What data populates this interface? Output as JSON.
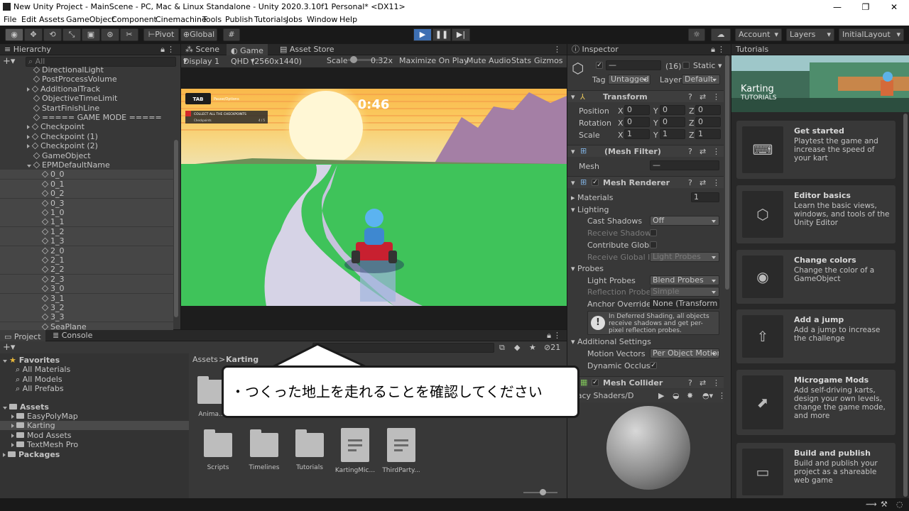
{
  "window": {
    "title": "New Unity Project - MainScene - PC, Mac & Linux Standalone - Unity 2020.3.10f1 Personal* <DX11>",
    "controls": {
      "minimize": "—",
      "maximize": "❐",
      "close": "✕"
    }
  },
  "menu": [
    "File",
    "Edit",
    "Assets",
    "GameObject",
    "Component",
    "Cinemachine",
    "Tools",
    "Publish",
    "Tutorials",
    "Jobs",
    "Window",
    "Help"
  ],
  "toolbar": {
    "pivot": "Pivot",
    "global": "Global",
    "account": "Account",
    "layers": "Layers",
    "layout": "InitialLayout"
  },
  "hierarchy": {
    "tab": "Hierarchy",
    "search_placeholder": "All",
    "items": [
      {
        "label": "DirectionalLight",
        "indent": 1,
        "arrow": "none"
      },
      {
        "label": "PostProcessVolume",
        "indent": 1,
        "arrow": "none"
      },
      {
        "label": "AdditionalTrack",
        "indent": 1,
        "arrow": "right"
      },
      {
        "label": "ObjectiveTimeLimit",
        "indent": 1,
        "arrow": "none"
      },
      {
        "label": "StartFinishLine",
        "indent": 1,
        "arrow": "none"
      },
      {
        "label": "===== GAME MODE =====",
        "indent": 1,
        "arrow": "none"
      },
      {
        "label": "Checkpoint",
        "indent": 1,
        "arrow": "right"
      },
      {
        "label": "Checkpoint (1)",
        "indent": 1,
        "arrow": "right"
      },
      {
        "label": "Checkpoint (2)",
        "indent": 1,
        "arrow": "right"
      },
      {
        "label": "GameObject",
        "indent": 1,
        "arrow": "none"
      },
      {
        "label": "EPMDefaultName",
        "indent": 1,
        "arrow": "down"
      },
      {
        "label": "0_0",
        "indent": 2,
        "arrow": "none"
      },
      {
        "label": "0_1",
        "indent": 2,
        "arrow": "none"
      },
      {
        "label": "0_2",
        "indent": 2,
        "arrow": "none"
      },
      {
        "label": "0_3",
        "indent": 2,
        "arrow": "none"
      },
      {
        "label": "1_0",
        "indent": 2,
        "arrow": "none"
      },
      {
        "label": "1_1",
        "indent": 2,
        "arrow": "none"
      },
      {
        "label": "1_2",
        "indent": 2,
        "arrow": "none"
      },
      {
        "label": "1_3",
        "indent": 2,
        "arrow": "none"
      },
      {
        "label": "2_0",
        "indent": 2,
        "arrow": "none"
      },
      {
        "label": "2_1",
        "indent": 2,
        "arrow": "none"
      },
      {
        "label": "2_2",
        "indent": 2,
        "arrow": "none"
      },
      {
        "label": "2_3",
        "indent": 2,
        "arrow": "none"
      },
      {
        "label": "3_0",
        "indent": 2,
        "arrow": "none"
      },
      {
        "label": "3_1",
        "indent": 2,
        "arrow": "none"
      },
      {
        "label": "3_2",
        "indent": 2,
        "arrow": "none"
      },
      {
        "label": "3_3",
        "indent": 2,
        "arrow": "none"
      },
      {
        "label": "SeaPlane",
        "indent": 2,
        "arrow": "none"
      }
    ]
  },
  "game": {
    "tabs": {
      "scene": "Scene",
      "game": "Game",
      "asset_store": "Asset Store"
    },
    "display": "Display 1",
    "resolution": "QHD (2560x1440)",
    "scale_label": "Scale",
    "scale_value": "0.32x",
    "maximize": "Maximize On Play",
    "mute": "Mute Audio",
    "stats": "Stats",
    "gizmos": "Gizmos",
    "hud": {
      "tab_key": "TAB",
      "pause": "Pause/Options",
      "objective": "COLLECT ALL THE CHECKPOINTS",
      "checkpoints_label": "Checkpoints",
      "checkpoints_value": "4 / 5",
      "timer": "0:46"
    }
  },
  "inspector": {
    "tab": "Inspector",
    "object_name": "—",
    "layer_index": "(16)",
    "static": "Static",
    "tag_label": "Tag",
    "tag_value": "Untagged",
    "layer_label": "Layer",
    "layer_value": "Default",
    "transform": {
      "title": "Transform",
      "position": "Position",
      "rotation": "Rotation",
      "scale": "Scale",
      "x": "X",
      "y": "Y",
      "z": "Z",
      "pos": [
        "0",
        "0",
        "0"
      ],
      "rot": [
        "0",
        "0",
        "0"
      ],
      "scl": [
        "1",
        "1",
        "1"
      ]
    },
    "mesh_filter": {
      "title": "(Mesh Filter)",
      "mesh_label": "Mesh",
      "mesh_value": "—"
    },
    "mesh_renderer": {
      "title": "Mesh Renderer",
      "materials": "Materials",
      "materials_count": "1",
      "lighting": "Lighting",
      "cast_shadows": "Cast Shadows",
      "cast_shadows_value": "Off",
      "receive_shadows": "Receive Shadows",
      "contribute_gi": "Contribute Global",
      "receive_gi": "Receive Global Illu",
      "receive_gi_value": "Light Probes",
      "probes": "Probes",
      "light_probes": "Light Probes",
      "light_probes_value": "Blend Probes",
      "reflection_probes": "Reflection Probes",
      "reflection_probes_value": "Simple",
      "anchor_override": "Anchor Override",
      "anchor_override_value": "None (Transform",
      "info": "In Deferred Shading, all objects receive shadows and get per-pixel reflection probes.",
      "additional": "Additional Settings",
      "motion_vectors": "Motion Vectors",
      "motion_vectors_value": "Per Object Motion",
      "dynamic_occlusion": "Dynamic Occlusio"
    },
    "mesh_collider": {
      "title": "Mesh Collider"
    },
    "material_shader": "egacy Shaders/D"
  },
  "tutorials": {
    "tab": "Tutorials",
    "header_title": "Karting",
    "header_sub": "TUTORIALS",
    "cards": [
      {
        "title": "Get started",
        "desc": "Playtest the game and increase the speed of your kart"
      },
      {
        "title": "Editor basics",
        "desc": "Learn the basic views, windows, and tools of the Unity Editor"
      },
      {
        "title": "Change colors",
        "desc": "Change the color of a GameObject"
      },
      {
        "title": "Add a jump",
        "desc": "Add a jump to increase the challenge"
      },
      {
        "title": "Microgame Mods",
        "desc": "Add self-driving karts, design your own levels, change the game mode, and more"
      },
      {
        "title": "Build and publish",
        "desc": "Build and publish your project as a shareable web game"
      }
    ]
  },
  "project": {
    "tabs": {
      "project": "Project",
      "console": "Console"
    },
    "hidden_count": "21",
    "favorites": "Favorites",
    "favorite_items": [
      "All Materials",
      "All Models",
      "All Prefabs"
    ],
    "assets": "Assets",
    "asset_items": [
      "EasyPolyMap",
      "Karting",
      "Mod Assets",
      "TextMesh Pro"
    ],
    "packages": "Packages",
    "breadcrumb": {
      "root": "Assets",
      "sep": ">",
      "current": "Karting"
    },
    "grid_items": [
      "Anima...",
      "Scripts",
      "Timelines",
      "Tutorials",
      "KartingMic...",
      "ThirdParty..."
    ]
  },
  "callout": {
    "text": "・つくった地上を走れることを確認してください"
  },
  "colors": {
    "accent": "#3d6fb3",
    "panel": "#383838",
    "dark": "#191919",
    "header": "#282828"
  }
}
